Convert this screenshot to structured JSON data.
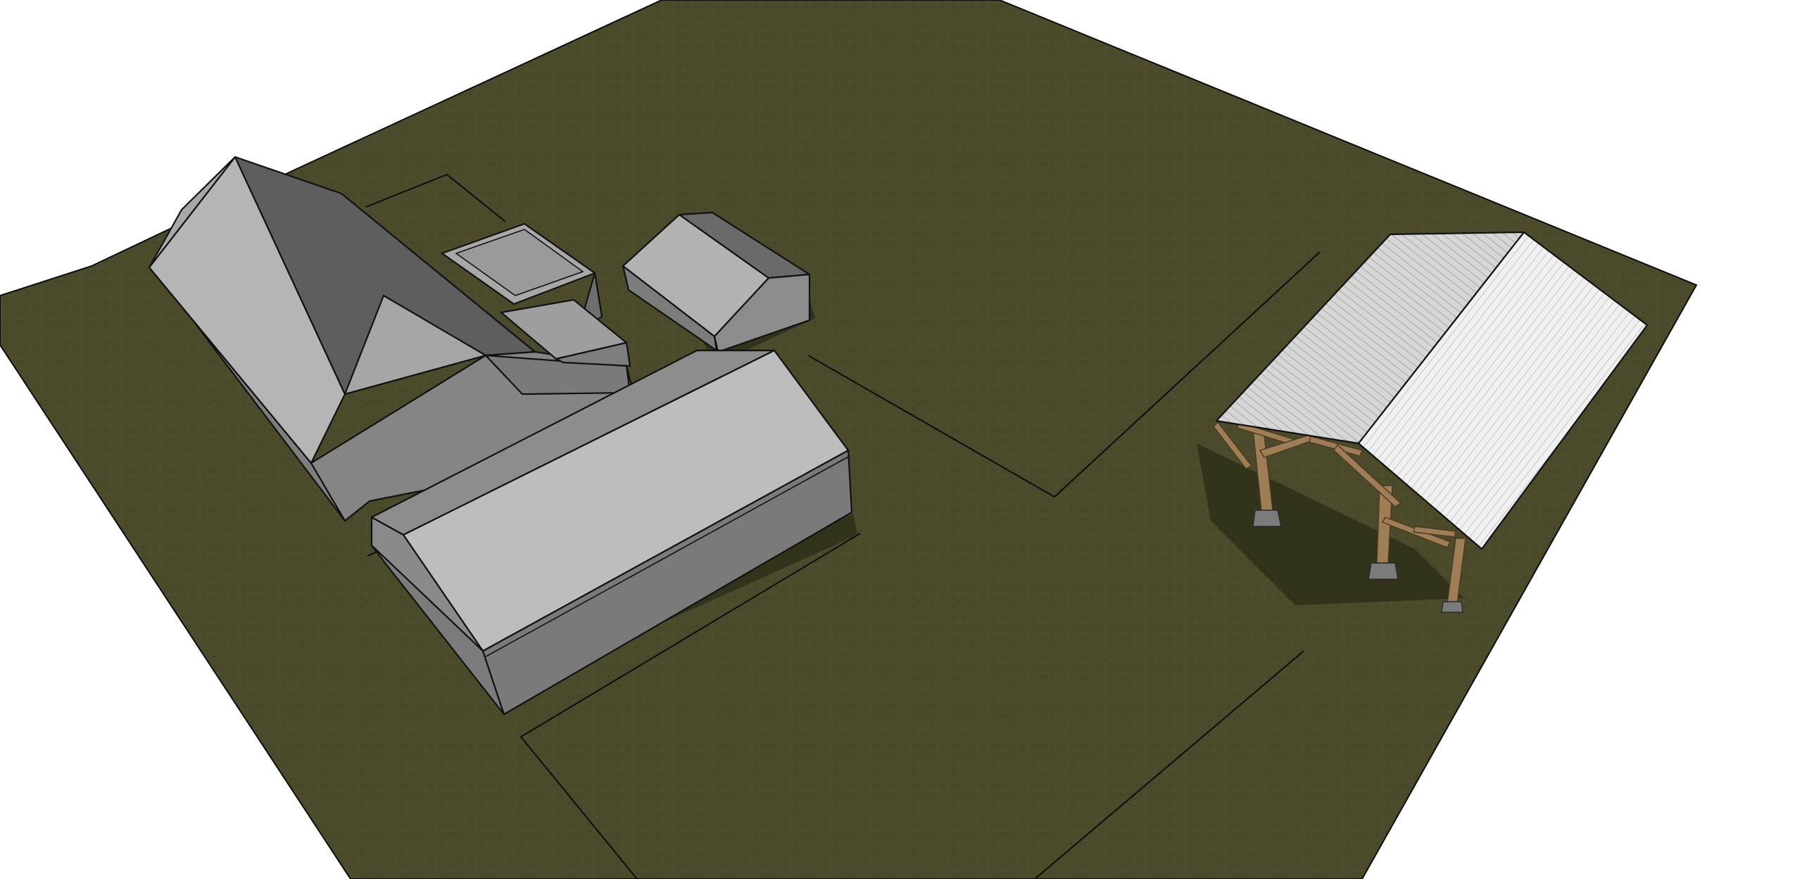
{
  "colors": {
    "background": "#ffffff",
    "ground": "#4b4a2b",
    "roof_light": "#bcbcbc",
    "roof_mid": "#9d9d9d",
    "roof_dark": "#5f5f5f",
    "wall_mid": "#8a8a8a",
    "wall_dark": "#6e6e6e",
    "metal_roof_light": "#e6e6e6",
    "metal_roof_mid": "#c9c9c9",
    "timber": "#9a7a52",
    "footing": "#7d7d7d",
    "line": "#111111"
  }
}
